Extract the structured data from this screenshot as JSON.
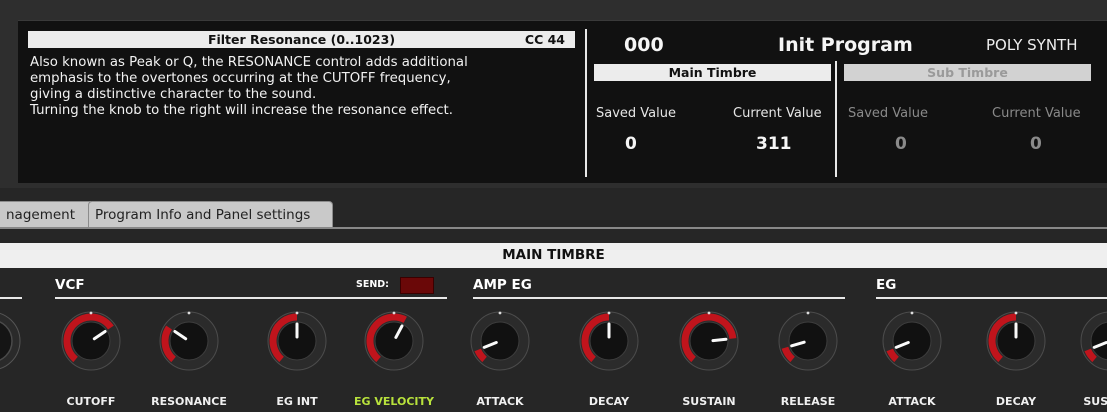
{
  "help": {
    "title": "Filter Resonance (0..1023)",
    "cc": "CC 44",
    "lines": [
      "Also known as Peak or Q, the RESONANCE control adds additional",
      "emphasis to the overtones occurring at the CUTOFF frequency,",
      "giving a distinctive character to the sound.",
      "Turning the knob to the right will increase the resonance effect."
    ]
  },
  "program": {
    "number": "000",
    "name": "Init Program",
    "type": "POLY SYNTH"
  },
  "main_timbre": {
    "header": "Main Timbre",
    "saved_label": "Saved Value",
    "current_label": "Current Value",
    "saved_value": "0",
    "current_value": "311"
  },
  "sub_timbre": {
    "header": "Sub Timbre",
    "saved_label": "Saved Value",
    "current_label": "Current Value",
    "saved_value": "0",
    "current_value": "0"
  },
  "tabs": [
    "nagement",
    "Program Info and Panel settings"
  ],
  "section_header": "MAIN TIMBRE",
  "sections": {
    "vcf": "VCF",
    "send": "SEND:",
    "amp_eg": "AMP EG",
    "eg": "EG"
  },
  "colors": {
    "arc_red": "#c0141c",
    "label_green": "#b8e23c",
    "send_led": "#6a0808"
  },
  "knobs": [
    {
      "label": "CUTOFF",
      "level": 0.7
    },
    {
      "label": "RESONANCE",
      "level": 0.3
    },
    {
      "label": "EG INT",
      "level": 0.5
    },
    {
      "label": "EG VELOCITY",
      "level": 0.6
    },
    {
      "label": "ATTACK",
      "level": 0.1
    },
    {
      "label": "DECAY",
      "level": 0.5
    },
    {
      "label": "SUSTAIN",
      "level": 0.8
    },
    {
      "label": "RELEASE",
      "level": 0.12
    },
    {
      "label": "ATTACK",
      "level": 0.1
    },
    {
      "label": "DECAY",
      "level": 0.5
    },
    {
      "label": "SUSTAIN",
      "level": 0.1
    }
  ]
}
